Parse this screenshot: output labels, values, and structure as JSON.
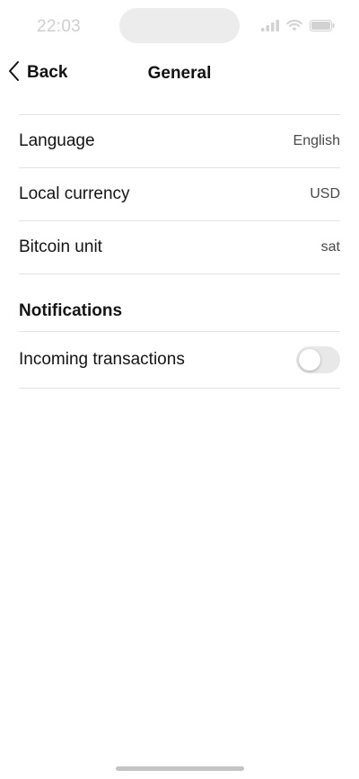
{
  "status_bar": {
    "time": "22:03",
    "icons": [
      "cellular-signal-icon",
      "wifi-icon",
      "battery-icon"
    ]
  },
  "nav": {
    "back_label": "Back",
    "title": "General"
  },
  "settings": {
    "rows": [
      {
        "label": "Language",
        "value": "English"
      },
      {
        "label": "Local currency",
        "value": "USD"
      },
      {
        "label": "Bitcoin unit",
        "value": "sat"
      }
    ]
  },
  "notifications": {
    "section_title": "Notifications",
    "incoming_transactions": {
      "label": "Incoming transactions",
      "enabled": false
    }
  },
  "colors": {
    "text_primary": "#111111",
    "text_secondary": "#4a4a4a",
    "divider": "#e3e3e3",
    "toggle_off": "#e8e8e8"
  }
}
